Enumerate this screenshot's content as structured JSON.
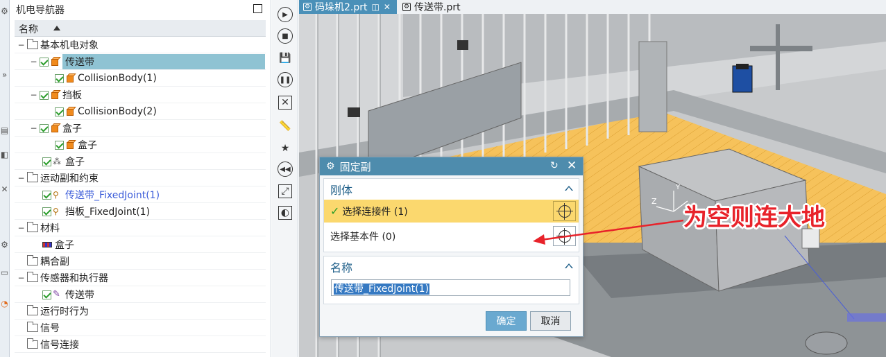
{
  "navigator": {
    "title": "机电导航器",
    "column_header": "名称",
    "items": [
      {
        "label": "基本机电对象"
      },
      {
        "label": "传送带"
      },
      {
        "label": "CollisionBody(1)"
      },
      {
        "label": "挡板"
      },
      {
        "label": "CollisionBody(2)"
      },
      {
        "label": "盒子"
      },
      {
        "label": "盒子"
      },
      {
        "label": "盒子"
      },
      {
        "label": "运动副和约束"
      },
      {
        "label": "传送带_FixedJoint(1)"
      },
      {
        "label": "挡板_FixedJoint(1)"
      },
      {
        "label": "材料"
      },
      {
        "label": "盒子"
      },
      {
        "label": "耦合副"
      },
      {
        "label": "传感器和执行器"
      },
      {
        "label": "传送带"
      },
      {
        "label": "运行时行为"
      },
      {
        "label": "信号"
      },
      {
        "label": "信号连接"
      }
    ]
  },
  "tabs": [
    {
      "label": "码垛机2.prt"
    },
    {
      "label": "传送带.prt"
    }
  ],
  "dialog": {
    "title": "固定副",
    "group_rigid": "刚体",
    "select_attach": "选择连接件 (1)",
    "select_base": "选择基本件 (0)",
    "group_name": "名称",
    "name_value": "传送带_FixedJoint(1)",
    "ok_label": "确定",
    "cancel_label": "取消"
  },
  "annotation": {
    "text": "为空则连大地",
    "color": "#e8222a"
  },
  "colors": {
    "accent": "#4e8cad",
    "selection": "#8fc3d3",
    "active_select": "#fbd86e"
  }
}
